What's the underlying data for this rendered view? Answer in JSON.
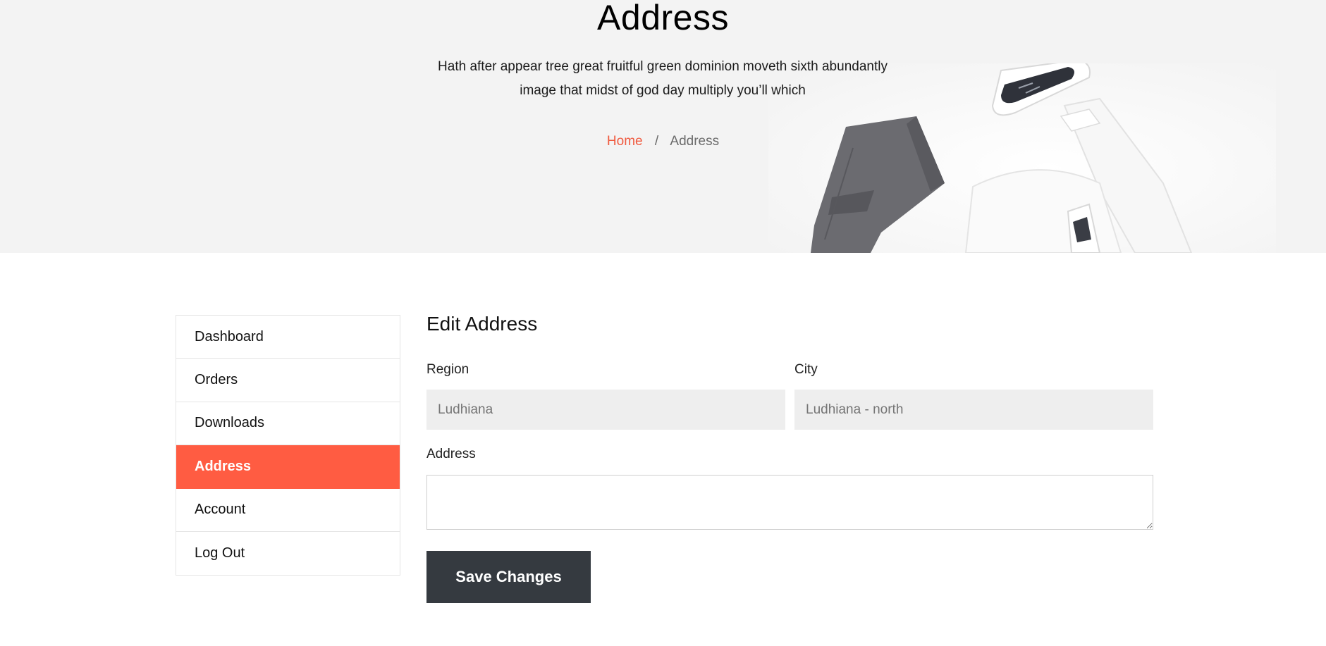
{
  "hero": {
    "title": "Address",
    "description_line1": "Hath after appear tree great fruitful green dominion moveth sixth abundantly",
    "description_line2": "image that midst of god day multiply you’ll which",
    "breadcrumb": {
      "home": "Home",
      "separator": "/",
      "current": "Address"
    }
  },
  "sidebar": {
    "items": [
      {
        "label": "Dashboard",
        "active": false
      },
      {
        "label": "Orders",
        "active": false
      },
      {
        "label": "Downloads",
        "active": false
      },
      {
        "label": "Address",
        "active": true
      },
      {
        "label": "Account",
        "active": false
      },
      {
        "label": "Log Out",
        "active": false
      }
    ]
  },
  "form": {
    "title": "Edit Address",
    "region": {
      "label": "Region",
      "placeholder": "Ludhiana"
    },
    "city": {
      "label": "City",
      "placeholder": "Ludhiana - north"
    },
    "address": {
      "label": "Address",
      "value": ""
    },
    "save_label": "Save Changes"
  },
  "colors": {
    "accent": "#ff5c42",
    "breadcrumb_link": "#f05a3f",
    "button_bg": "#353a40",
    "hero_bg": "#f3f3f3",
    "input_bg": "#eeeeee"
  }
}
